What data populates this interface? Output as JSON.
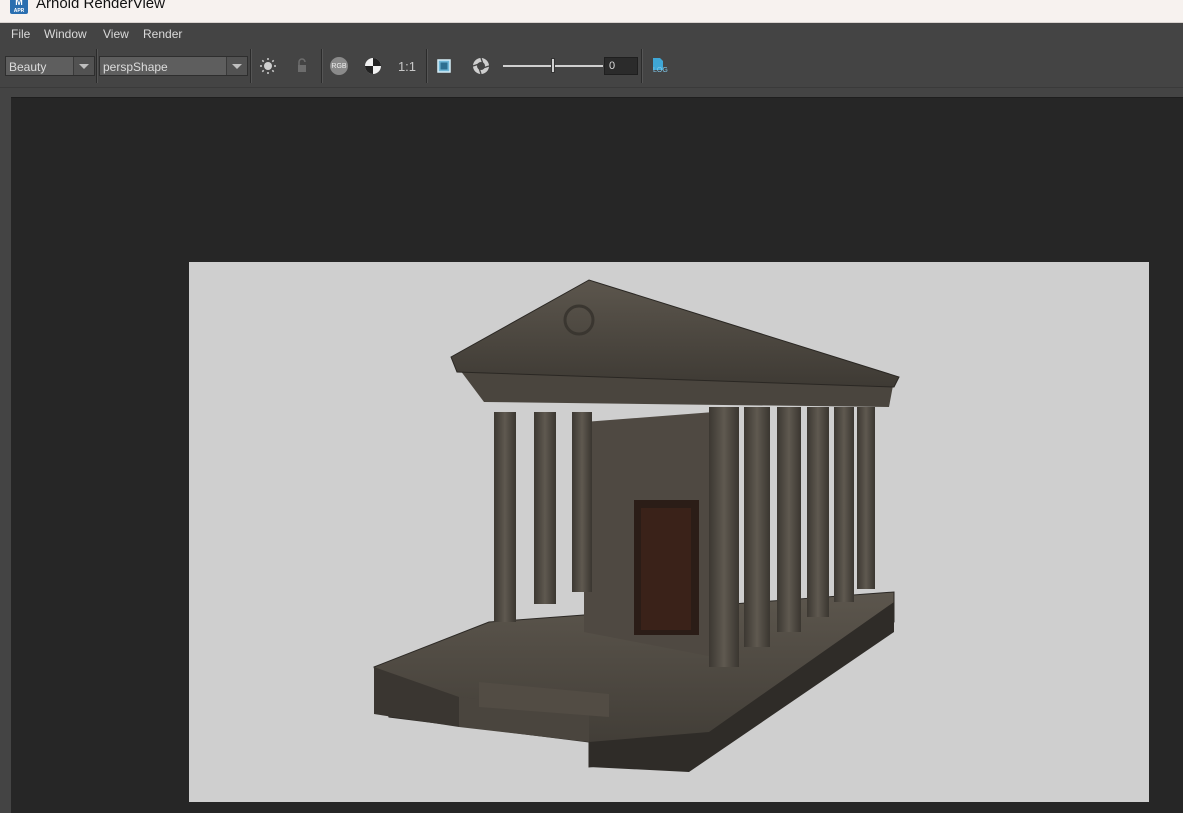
{
  "window": {
    "title": "Arnold RenderView",
    "app_icon_label": "M",
    "app_icon_sublabel": "APR"
  },
  "menubar": {
    "items": [
      {
        "label": "File"
      },
      {
        "label": "Window"
      },
      {
        "label": "View"
      },
      {
        "label": "Render"
      }
    ]
  },
  "toolbar": {
    "aov_value": "Beauty",
    "camera_value": "perspShape",
    "channel_button": "RGB",
    "ratio_label": "1:1",
    "exposure_value": "0",
    "exposure_level": 0.5,
    "log_label": "LOG"
  },
  "render": {
    "subject": "3D render of a stone classical temple with columns and a wooden door on a light gray background"
  }
}
